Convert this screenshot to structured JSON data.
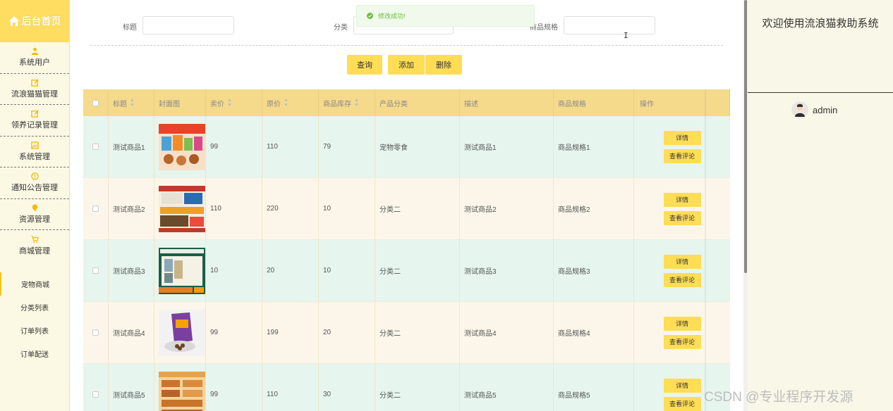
{
  "sidebar": {
    "home_label": "后台首页",
    "items": [
      {
        "label": "系统用户",
        "icon": "user-icon"
      },
      {
        "label": "流浪猫猫管理",
        "icon": "edit-icon"
      },
      {
        "label": "领养记录管理",
        "icon": "edit-icon"
      },
      {
        "label": "系统管理",
        "icon": "picture-icon"
      },
      {
        "label": "通知公告管理",
        "icon": "warning-icon"
      },
      {
        "label": "资源管理",
        "icon": "location-icon"
      },
      {
        "label": "商城管理",
        "icon": "cart-icon"
      }
    ],
    "subitems": [
      {
        "label": "宠物商城",
        "active": true
      },
      {
        "label": "分类列表"
      },
      {
        "label": "订单列表"
      },
      {
        "label": "订单配送"
      }
    ]
  },
  "search": {
    "title_label": "标题",
    "category_label": "分类",
    "spec_label": "商品规格",
    "title_value": "",
    "category_value": "",
    "spec_value": ""
  },
  "buttons": {
    "query": "查询",
    "add": "添加",
    "delete": "删除"
  },
  "toast": {
    "message": "修改成功!",
    "color": "#67c23a"
  },
  "table": {
    "headers": [
      "标题",
      "封面图",
      "卖价",
      "原价",
      "商品库存",
      "产品分类",
      "描述",
      "商品规格",
      "操作"
    ],
    "rows": [
      {
        "title": "测试商品1",
        "price": "99",
        "original": "110",
        "stock": "79",
        "category": "宠物零食",
        "desc": "测试商品1",
        "spec": "商品规格1"
      },
      {
        "title": "测试商品2",
        "price": "110",
        "original": "220",
        "stock": "10",
        "category": "分类二",
        "desc": "测试商品2",
        "spec": "商品规格2"
      },
      {
        "title": "测试商品3",
        "price": "10",
        "original": "20",
        "stock": "10",
        "category": "分类二",
        "desc": "测试商品3",
        "spec": "商品规格3"
      },
      {
        "title": "测试商品4",
        "price": "99",
        "original": "199",
        "stock": "20",
        "category": "分类二",
        "desc": "测试商品4",
        "spec": "商品规格4"
      },
      {
        "title": "测试商品5",
        "price": "99",
        "original": "110",
        "stock": "30",
        "category": "分类二",
        "desc": "测试商品5",
        "spec": "商品规格5"
      }
    ],
    "detail_label": "详情",
    "comment_label": "查看评论"
  },
  "right_panel": {
    "welcome": "欢迎使用流浪猫救助系统",
    "username": "admin"
  },
  "watermark": "CSDN @专业程序开发源",
  "colors": {
    "accent": "#ffdd55",
    "header_bg": "#f5da8c",
    "row_alt_a": "#e7f5ef",
    "row_alt_b": "#fcf6ea"
  }
}
